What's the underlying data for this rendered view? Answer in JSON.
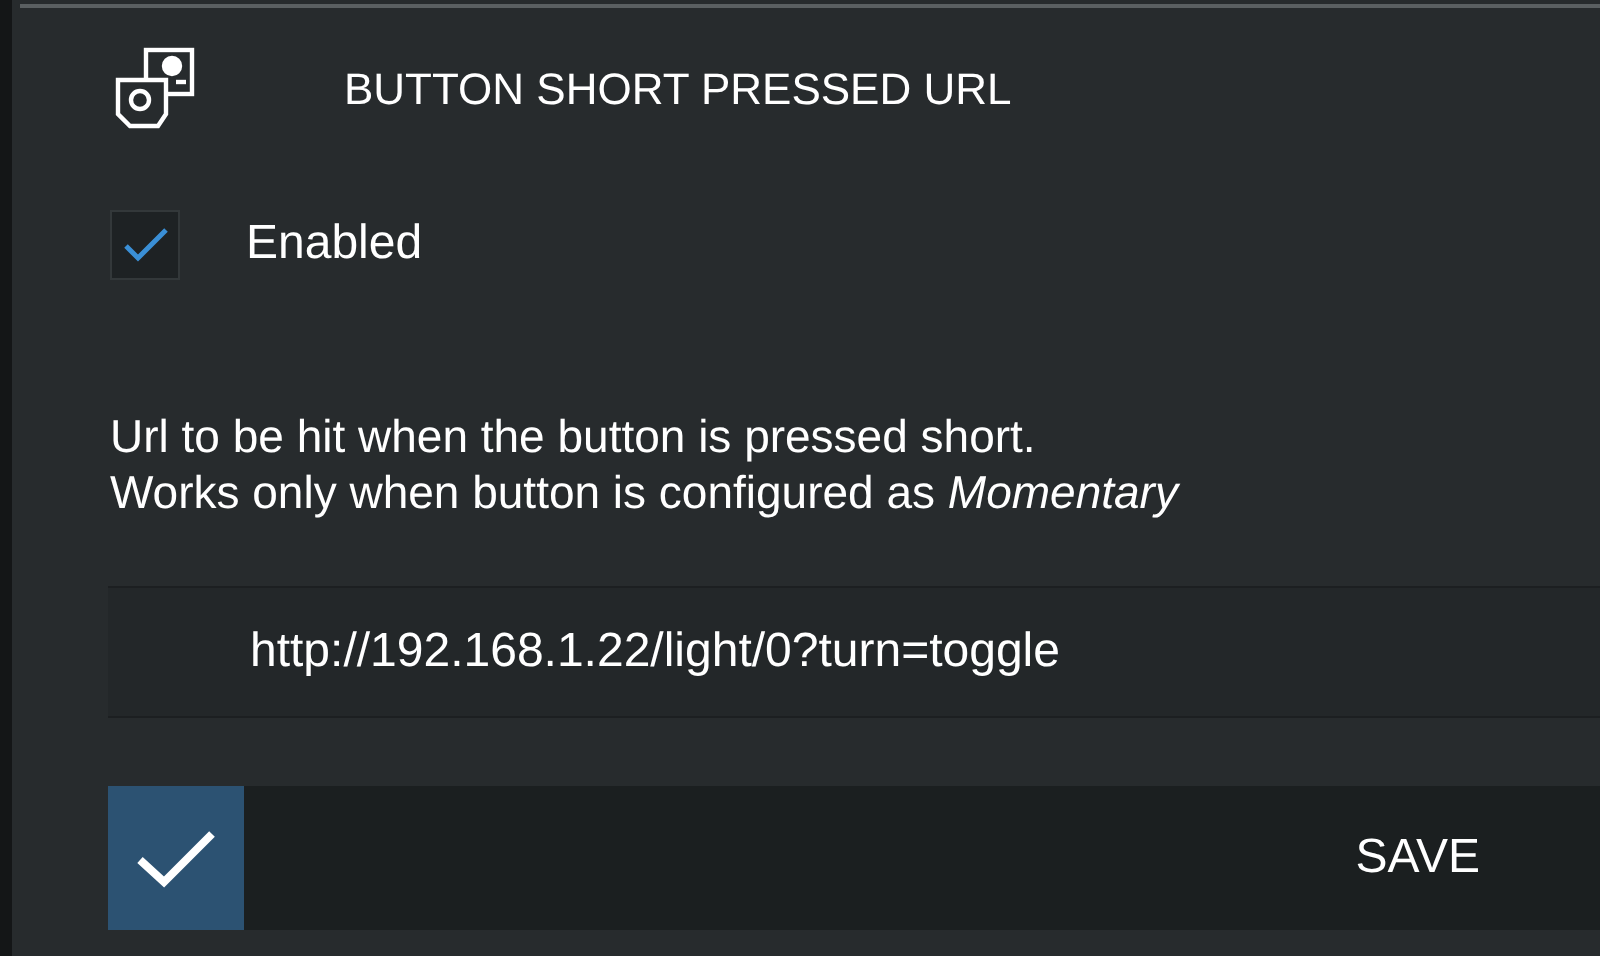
{
  "header": {
    "title": "BUTTON SHORT PRESSED URL"
  },
  "enabled": {
    "label": "Enabled",
    "checked": true
  },
  "description": [
    "Url to be hit when the button is pressed short.",
    "Works only when button is configured as *Momentary*"
  ],
  "url_field": {
    "value": "http://192.168.1.22/light/0?turn=toggle"
  },
  "save": {
    "label": "SAVE"
  }
}
